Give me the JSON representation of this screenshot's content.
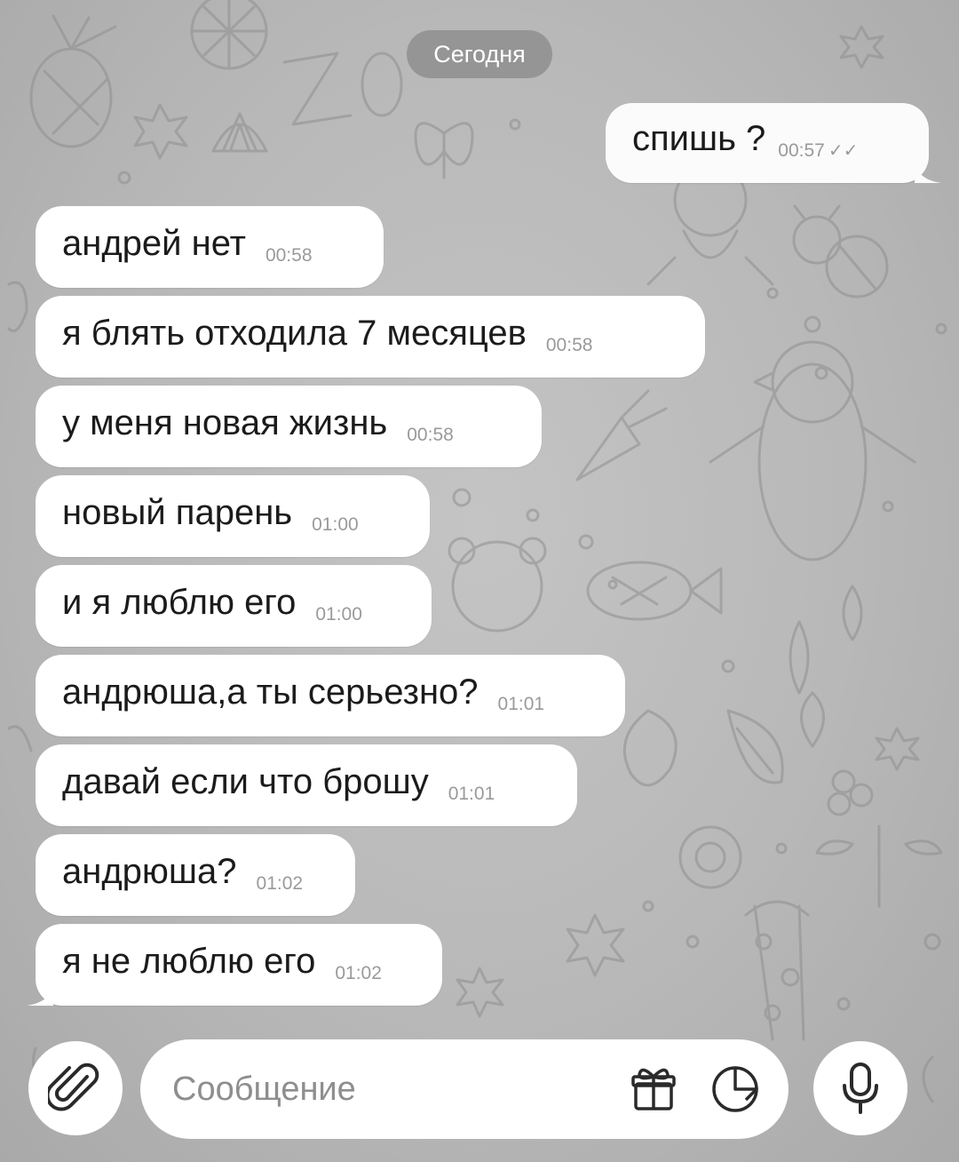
{
  "date_chip": "Сегодня",
  "outgoing": {
    "text": "спишь ?",
    "time": "00:57",
    "status": "read"
  },
  "messages": [
    {
      "text": "андрей нет",
      "time": "00:58"
    },
    {
      "text": "я блять отходила 7 месяцев",
      "time": "00:58"
    },
    {
      "text": "у меня новая жизнь",
      "time": "00:58"
    },
    {
      "text": "новый парень",
      "time": "01:00"
    },
    {
      "text": "и я люблю его",
      "time": "01:00"
    },
    {
      "text": "андрюша,а ты серьезно?",
      "time": "01:01"
    },
    {
      "text": "давай если что брошу",
      "time": "01:01"
    },
    {
      "text": "андрюша?",
      "time": "01:02"
    },
    {
      "text": "я не люблю его",
      "time": "01:02"
    }
  ],
  "composer": {
    "placeholder": "Сообщение",
    "attach_icon": "paperclip-icon",
    "gift_icon": "gift-icon",
    "sticker_icon": "sticker-icon",
    "mic_icon": "microphone-icon"
  },
  "colors": {
    "bubble": "#ffffff",
    "wallpaper": "#b9b9b9",
    "date_chip": "#7a7a7a",
    "timestamp": "#9a9a9a"
  }
}
